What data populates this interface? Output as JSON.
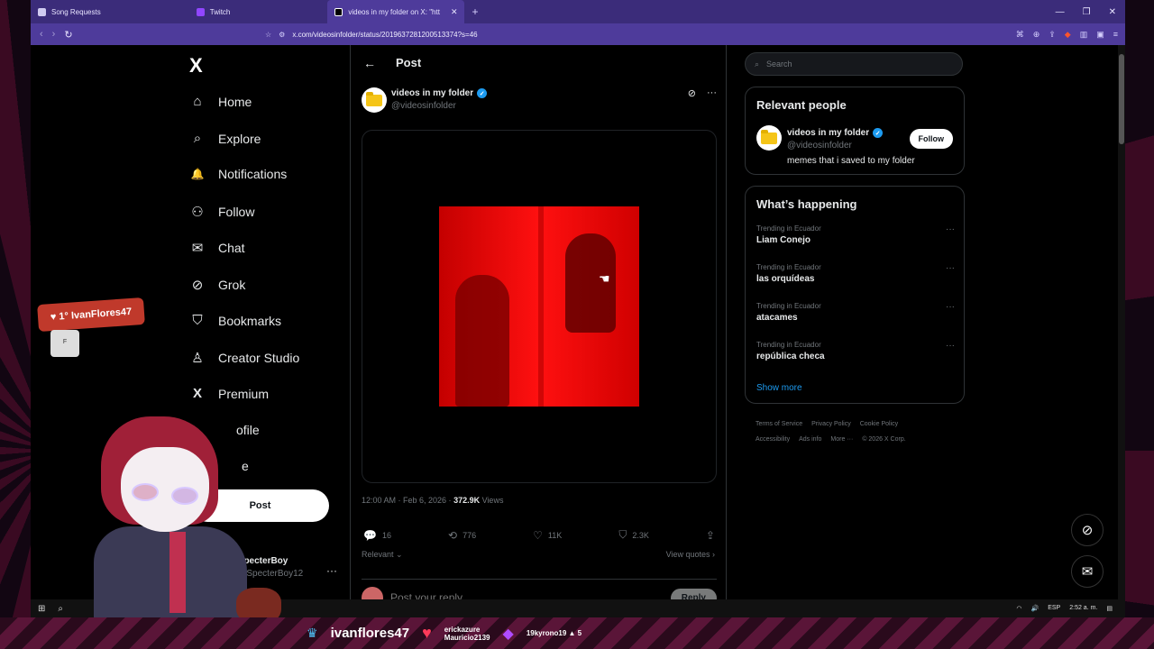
{
  "browser": {
    "tabs": [
      {
        "label": "Song Requests",
        "active": false
      },
      {
        "label": "Twitch",
        "active": false
      },
      {
        "label": "videos in my folder on X: \"htt",
        "active": true
      }
    ],
    "url": "x.com/videosinfolder/status/2019637281200513374?s=46",
    "new_tab": "+",
    "win_controls": [
      "—",
      "❐",
      "✕"
    ]
  },
  "nav": {
    "logo": "X",
    "items": [
      {
        "label": "Home",
        "icon": "home-icon",
        "glyph": "⌂"
      },
      {
        "label": "Explore",
        "icon": "search-icon",
        "glyph": "⌕"
      },
      {
        "label": "Notifications",
        "icon": "bell-icon",
        "glyph": "🔔"
      },
      {
        "label": "Follow",
        "icon": "person-add-icon",
        "glyph": "⚇"
      },
      {
        "label": "Chat",
        "icon": "mail-icon",
        "glyph": "✉"
      },
      {
        "label": "Grok",
        "icon": "grok-icon",
        "glyph": "⊘"
      },
      {
        "label": "Bookmarks",
        "icon": "bookmark-icon",
        "glyph": "⛉"
      },
      {
        "label": "Creator Studio",
        "icon": "creator-studio-icon",
        "glyph": "♙"
      },
      {
        "label": "Premium",
        "icon": "x-premium-icon",
        "glyph": "X"
      },
      {
        "label": "ofile",
        "icon": "profile-icon",
        "glyph": ""
      },
      {
        "label": "e",
        "icon": "more-icon",
        "glyph": ""
      }
    ],
    "post_button": "Post",
    "profile": {
      "name": "TheSpecterBoy",
      "handle": "@TheSpecterBoy12"
    }
  },
  "post": {
    "header_title": "Post",
    "author_name": "videos in my folder",
    "author_handle": "@videosinfolder",
    "timestamp": "12:00 AM · Feb 6, 2026 · ",
    "views_count": "372.9K",
    "views_label": " Views",
    "stats": {
      "replies": "16",
      "reposts": "776",
      "likes": "11K",
      "bookmarks": "2.3K"
    },
    "sort_label": "Relevant ⌄",
    "view_quotes": "View quotes ›",
    "reply_placeholder": "Post your reply",
    "reply_button": "Reply"
  },
  "sidebar": {
    "search_placeholder": "Search",
    "relevant_title": "Relevant people",
    "person": {
      "name": "videos in my folder",
      "handle": "@videosinfolder",
      "bio": "memes that i saved to my folder",
      "follow": "Follow"
    },
    "happening_title": "What’s happening",
    "trends": [
      {
        "context": "Trending in Ecuador",
        "title": "Liam Conejo"
      },
      {
        "context": "Trending in Ecuador",
        "title": "las orquídeas"
      },
      {
        "context": "Trending in Ecuador",
        "title": "atacames"
      },
      {
        "context": "Trending in Ecuador",
        "title": "república checa"
      }
    ],
    "show_more": "Show more",
    "footer": [
      "Terms of Service",
      "Privacy Policy",
      "Cookie Policy",
      "Accessibility",
      "Ads info",
      "More ···",
      "© 2026 X Corp."
    ]
  },
  "taskbar": {
    "lang": "ESP",
    "time": "2:52 a. m."
  },
  "overlay": {
    "badge": "♥ 1° IvanFlores47",
    "badge_sub": "F",
    "username": "ivanflores47",
    "users_line1": "erickazure",
    "users_line2": "Mauricio2139",
    "count": "19kyrono19 ▲ 5"
  },
  "colors": {
    "accent": "#1d9bf0",
    "browser": "#4e3b9b",
    "video": "#ff1010"
  }
}
